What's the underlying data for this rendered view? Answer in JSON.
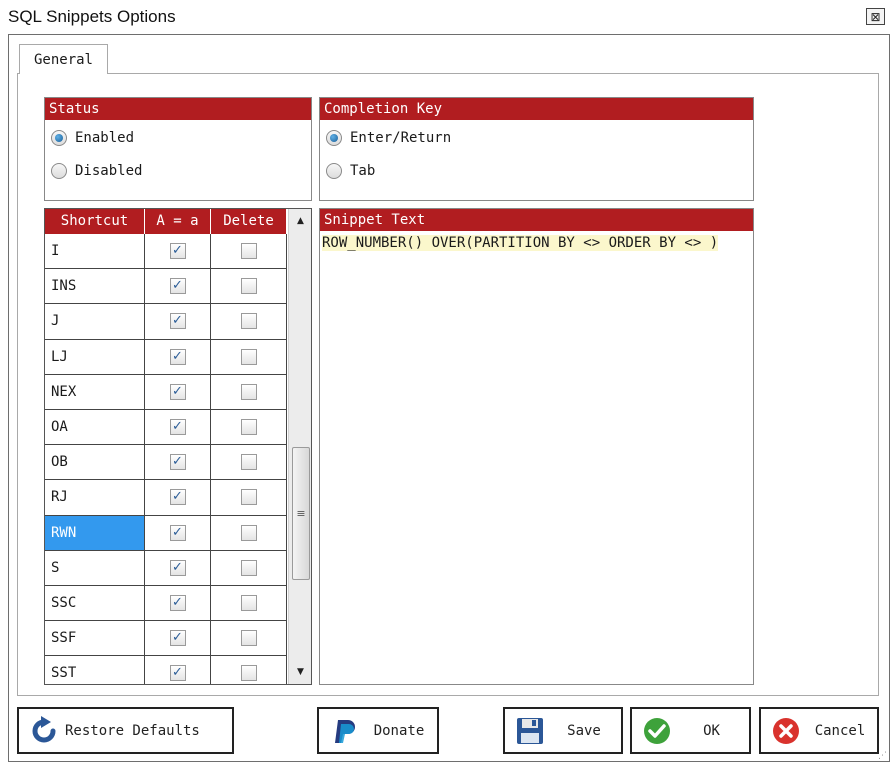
{
  "window": {
    "title": "SQL Snippets Options",
    "close_glyph": "⊠"
  },
  "tabs": [
    {
      "label": "General",
      "active": true
    }
  ],
  "status_group": {
    "header": "Status",
    "options": [
      {
        "label": "Enabled",
        "selected": true
      },
      {
        "label": "Disabled",
        "selected": false
      }
    ]
  },
  "completion_group": {
    "header": "Completion Key",
    "options": [
      {
        "label": "Enter/Return",
        "selected": true
      },
      {
        "label": "Tab",
        "selected": false
      }
    ]
  },
  "grid": {
    "columns": [
      "Shortcut",
      "A = a",
      "Delete"
    ],
    "rows": [
      {
        "shortcut": "I",
        "case_sensitive": true,
        "delete": false
      },
      {
        "shortcut": "INS",
        "case_sensitive": true,
        "delete": false
      },
      {
        "shortcut": "J",
        "case_sensitive": true,
        "delete": false
      },
      {
        "shortcut": "LJ",
        "case_sensitive": true,
        "delete": false
      },
      {
        "shortcut": "NEX",
        "case_sensitive": true,
        "delete": false
      },
      {
        "shortcut": "OA",
        "case_sensitive": true,
        "delete": false
      },
      {
        "shortcut": "OB",
        "case_sensitive": true,
        "delete": false
      },
      {
        "shortcut": "RJ",
        "case_sensitive": true,
        "delete": false
      },
      {
        "shortcut": "RWN",
        "case_sensitive": true,
        "delete": false,
        "selected": true
      },
      {
        "shortcut": "S",
        "case_sensitive": true,
        "delete": false
      },
      {
        "shortcut": "SSC",
        "case_sensitive": true,
        "delete": false
      },
      {
        "shortcut": "SSF",
        "case_sensitive": true,
        "delete": false
      },
      {
        "shortcut": "SST",
        "case_sensitive": true,
        "delete": false
      }
    ],
    "scroll": {
      "up_glyph": "▲",
      "down_glyph": "▼",
      "thumb_glyph": "≡"
    }
  },
  "snippet": {
    "header": "Snippet Text",
    "text": "ROW_NUMBER() OVER(PARTITION BY <> ORDER BY <> )"
  },
  "buttons": {
    "restore": "Restore Defaults",
    "donate": "Donate",
    "save": "Save",
    "ok": "OK",
    "cancel": "Cancel"
  },
  "colors": {
    "header_red": "#b11d20",
    "selection_blue": "#3399ee",
    "snippet_highlight": "#fbf7cc",
    "ok_green": "#3ea23b",
    "cancel_red": "#d9322d",
    "icon_blue": "#2b5797"
  },
  "icons": {
    "restore": "refresh-arrow-icon",
    "donate": "paypal-icon",
    "save": "floppy-disk-icon",
    "ok": "checkmark-icon",
    "cancel": "x-circle-icon"
  }
}
